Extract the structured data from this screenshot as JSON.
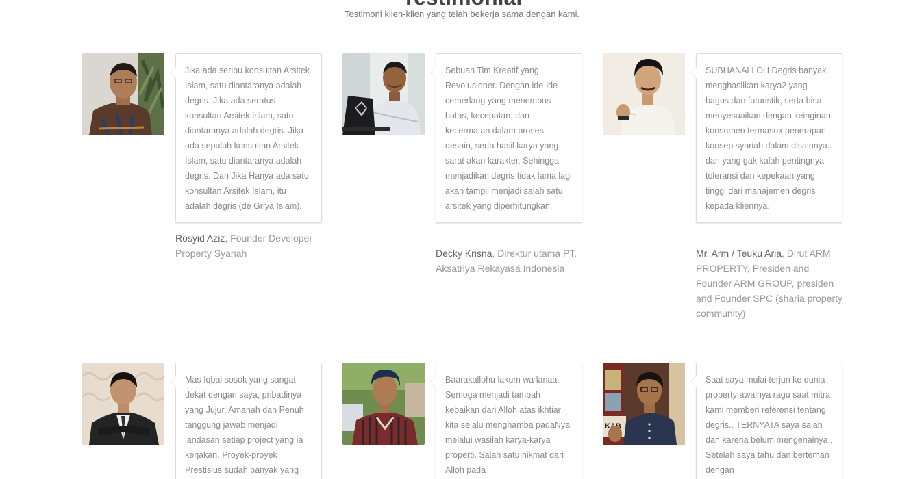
{
  "section": {
    "title": "Testimonial",
    "subtitle": "Testimoni klien-klien yang telah bekerja sama dengan kami."
  },
  "testimonials": [
    {
      "quote": "Jika ada seribu konsultan Arsitek Islam, satu diantaranya adalah degris. Jika ada seratus konsultan Arsitek Islam, satu diantaranya adalah degris. Jika ada sepuluh konsultan Arsitek Islam, satu diantaranya adalah degris. Dan Jika Hanya ada satu konsultan Arsitek Islam, itu adalah degris (de Griya Islam).",
      "name": "Rosyid Aziz",
      "role": ", Founder Developer Property Syariah"
    },
    {
      "quote": "Sebuah Tim Kreatif yang Revolusioner. Dengan ide-ide cemerlang yang menembus batas, kecepatan, dan kecermatan dalam proses desain, serta hasil karya yang sarat akan karakter. Sehingga menjadikan degris tidak lama lagi akan tampil menjadi salah satu arsitek yang diperhitungkan.",
      "name": "Decky Krisna",
      "role": ", Direktur utama PT. Aksatriya Rekayasa Indonesia"
    },
    {
      "quote": "SUBHANALLOH Degris banyak menghasilkan karya2 yang bagus dan futuristik, serta bisa menyesuaikan dengan keinginan konsumen termasuk penerapan konsep syariah dalam disainnya.. dan yang gak kalah pentingnya toleransi dan kepekaan yang tinggi dari manajemen degris kepada kliennya.",
      "name": "Mr. Arm / Teuku Aria",
      "role": ", Dirut ARM PROPERTY, Presiden and Founder ARM GROUP, presiden and Founder SPC (sharia property community)"
    },
    {
      "quote": "Mas Iqbal sosok yang sangat dekat dengan saya, pribadinya yang Jujur, Amanah dan Penuh tanggung jawab menjadi landasan setiap project yang ia kerjakan. Proyek-proyek Prestisius sudah banyak yang",
      "name": "",
      "role": ""
    },
    {
      "quote": "Baarakallohu lakum wa lanaa. Semoga menjadi tambah kebaikan dari Alloh atas ikhtiar kita selalu menghamba padaNya melalui wasilah karya-karya properti. Salah satu nikmat dari Alloh pada",
      "name": "",
      "role": ""
    },
    {
      "quote": "Saat saya mulai terjun ke dunia property awalnya ragu saat mitra kami memberi referensi tentang degris.. TERNYATA saya salah dan karena belum mengenalnya.. Setelah saya tahu dan berteman dengan",
      "name": "",
      "role": ""
    }
  ],
  "colors": {
    "bubble_border": "#dedede",
    "quote_text": "#8a8a8a",
    "name_text": "#666666",
    "role_text": "#999999"
  }
}
